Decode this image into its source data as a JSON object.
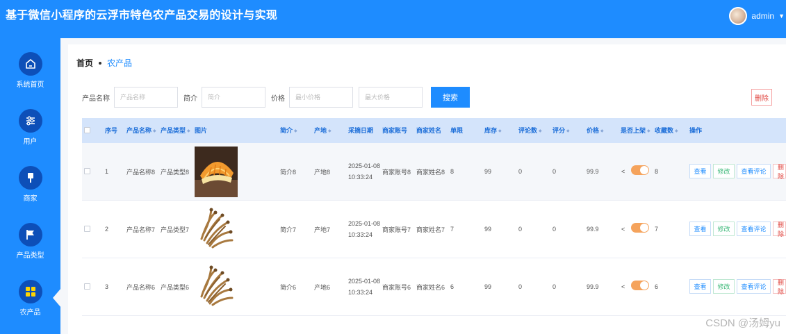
{
  "header": {
    "title": "基于微信小程序的云浮市特色农产品交易的设计与实现",
    "user_name": "admin",
    "user_caret": "▼"
  },
  "sidebar": {
    "items": [
      {
        "label": "系统首页",
        "icon": "home-icon"
      },
      {
        "label": "用户",
        "icon": "sliders-icon"
      },
      {
        "label": "商家",
        "icon": "brush-icon"
      },
      {
        "label": "产品类型",
        "icon": "flag-icon"
      },
      {
        "label": "农产品",
        "icon": "grid-icon"
      }
    ]
  },
  "breadcrumb": {
    "home": "首页",
    "current": "农产品"
  },
  "filter": {
    "name_label": "产品名称",
    "name_placeholder": "产品名称",
    "intro_label": "简介",
    "intro_placeholder": "简介",
    "price_label": "价格",
    "min_placeholder": "最小价格",
    "max_placeholder": "最大价格",
    "search_label": "搜索",
    "delete_label": "删除"
  },
  "table": {
    "headers": {
      "index": "序号",
      "name": "产品名称",
      "type": "产品类型",
      "image": "图片",
      "intro": "简介",
      "origin": "产地",
      "date": "采摘日期",
      "account": "商家账号",
      "merchant": "商家姓名",
      "unit": "单限",
      "stock": "库存",
      "reviews": "评论数",
      "score": "评分",
      "price": "价格",
      "listed": "是否上架",
      "favs": "收藏数",
      "ops": "操作"
    },
    "rows": [
      {
        "index": "1",
        "name": "产品名称8",
        "type": "产品类型8",
        "image": "cantaloupe",
        "intro": "简介8",
        "origin": "产地8",
        "date": "2025-01-08 10:33:24",
        "account": "商家账号8",
        "merchant": "商家姓名8",
        "unit": "8",
        "stock": "99",
        "reviews": "0",
        "score": "0",
        "price": "99.9",
        "listed": true,
        "favs": "8"
      },
      {
        "index": "2",
        "name": "产品名称7",
        "type": "产品类型7",
        "image": "mushroom",
        "intro": "简介7",
        "origin": "产地7",
        "date": "2025-01-08 10:33:24",
        "account": "商家账号7",
        "merchant": "商家姓名7",
        "unit": "7",
        "stock": "99",
        "reviews": "0",
        "score": "0",
        "price": "99.9",
        "listed": true,
        "favs": "7"
      },
      {
        "index": "3",
        "name": "产品名称6",
        "type": "产品类型6",
        "image": "mushroom",
        "intro": "简介6",
        "origin": "产地6",
        "date": "2025-01-08 10:33:24",
        "account": "商家账号6",
        "merchant": "商家姓名6",
        "unit": "6",
        "stock": "99",
        "reviews": "0",
        "score": "0",
        "price": "99.9",
        "listed": true,
        "favs": "6"
      }
    ],
    "actions": {
      "view": "查看",
      "edit": "修改",
      "reviews": "查看评论",
      "delete": "删除"
    },
    "share_glyph": "<"
  },
  "colors": {
    "primary": "#1e8cff",
    "sidebar_circle": "#0d4fb8",
    "switch_on": "#f5a35c",
    "danger": "#e0443e",
    "success": "#3ab877"
  },
  "watermark": "CSDN @汤姆yu"
}
